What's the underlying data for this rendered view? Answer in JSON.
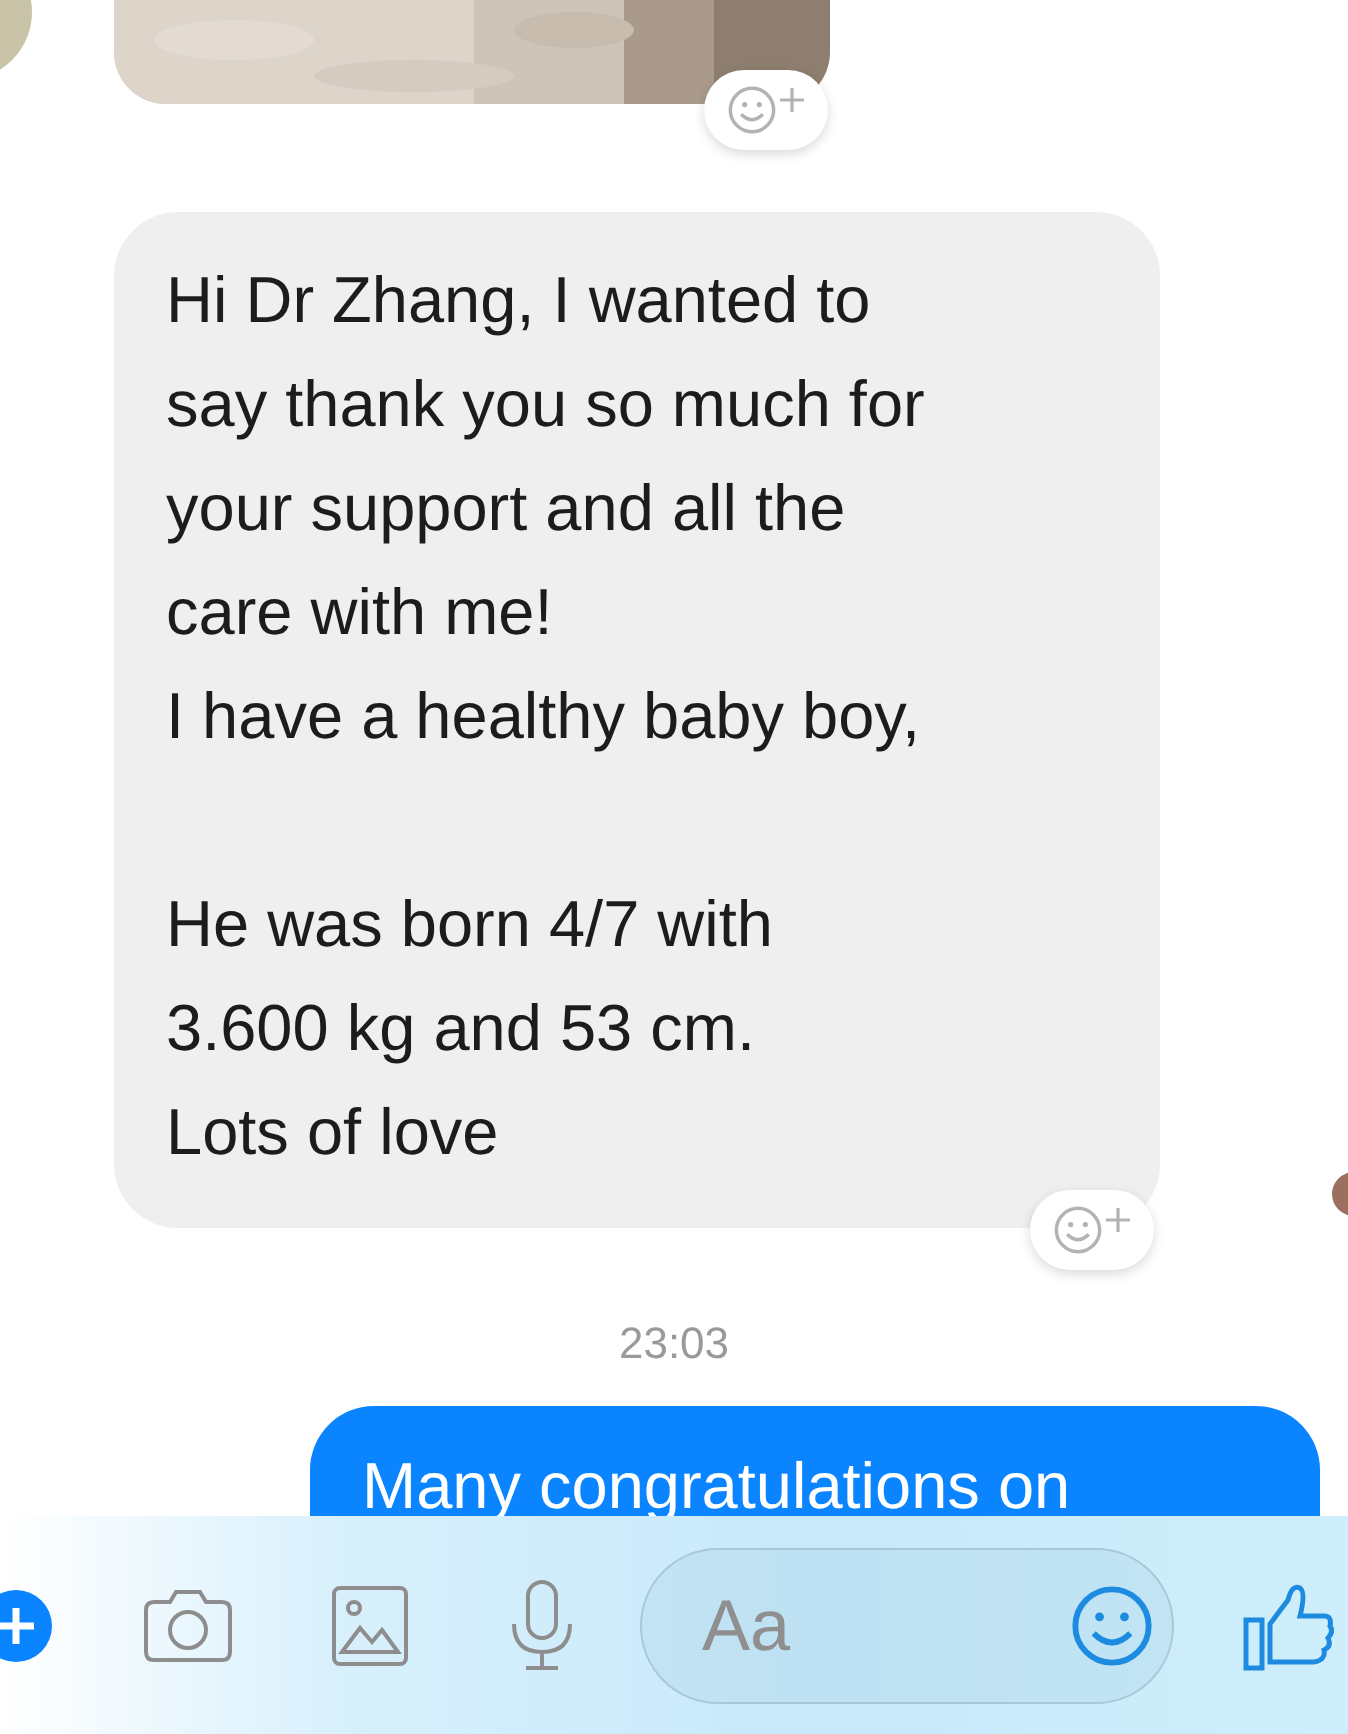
{
  "messages": [
    {
      "kind": "incoming_photo"
    },
    {
      "kind": "incoming_text",
      "text": "Hi Dr Zhang, I wanted to\nsay thank you so much for\nyour support and all the\ncare with me!\nI have a healthy baby boy,\n\nHe was born 4/7 with\n3.600 kg and 53 cm.\nLots of love"
    },
    {
      "kind": "timestamp",
      "text": "23:03"
    },
    {
      "kind": "outgoing_text",
      "text": "Many congratulations on"
    }
  ],
  "composer": {
    "placeholder": "Aa"
  }
}
